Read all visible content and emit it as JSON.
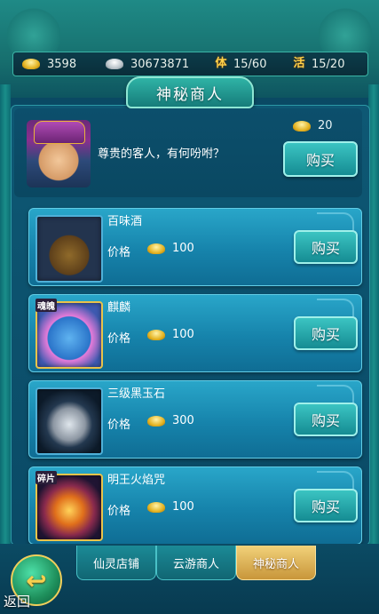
{
  "resources": {
    "gold": "3598",
    "silver": "30673871",
    "stamina_icon": "体",
    "stamina": "15/60",
    "vitality_icon": "活",
    "vitality": "15/20"
  },
  "title": "神秘商人",
  "merchant": {
    "greeting": "尊贵的客人，有何吩咐？",
    "refresh_price": "20",
    "buy_label": "购买"
  },
  "items": [
    {
      "name": "百味酒",
      "price_label": "价格",
      "price": "100",
      "buy_label": "购买",
      "icon": "wine-vessel-icon",
      "badge": ""
    },
    {
      "name": "麒麟",
      "price_label": "价格",
      "price": "100",
      "buy_label": "购买",
      "icon": "qilin-icon",
      "badge": "魂魄"
    },
    {
      "name": "三级黑玉石",
      "price_label": "价格",
      "price": "300",
      "buy_label": "购买",
      "icon": "black-jade-icon",
      "badge": ""
    },
    {
      "name": "明王火焰咒",
      "price_label": "价格",
      "price": "100",
      "buy_label": "购买",
      "icon": "fire-spell-icon",
      "badge": "碎片"
    }
  ],
  "tabs": [
    {
      "label": "仙灵店铺",
      "active": false
    },
    {
      "label": "云游商人",
      "active": false
    },
    {
      "label": "神秘商人",
      "active": true
    }
  ],
  "back_label": "返回",
  "colors": {
    "accent": "#1f8a86",
    "active_tab": "#e2b75a",
    "card": "#1683ab"
  }
}
